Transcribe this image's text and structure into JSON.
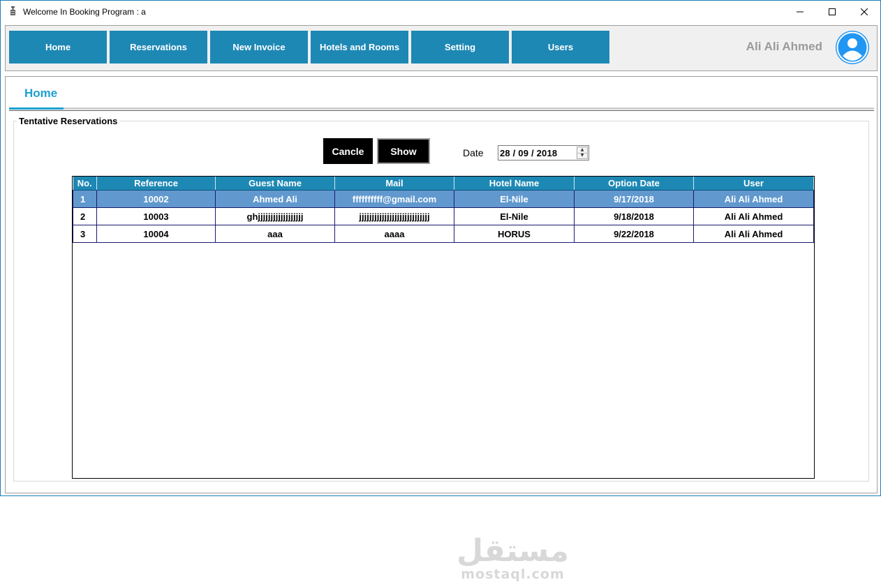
{
  "window": {
    "title": "Welcome In  Booking Program : a",
    "controls": [
      "minimize-icon",
      "maximize-icon",
      "close-icon"
    ]
  },
  "nav": {
    "items": [
      {
        "label": "Home"
      },
      {
        "label": "Reservations"
      },
      {
        "label": "New Invoice"
      },
      {
        "label": "Hotels and Rooms"
      },
      {
        "label": "Setting"
      },
      {
        "label": "Users"
      }
    ],
    "user_name": "Ali Ali Ahmed",
    "avatar_icon": "user-avatar-icon"
  },
  "tab": {
    "title": "Home"
  },
  "group": {
    "title": "Tentative Reservations"
  },
  "actions": {
    "cancel_label": "Cancle",
    "show_label": "Show",
    "date_label": "Date",
    "date_value": "28 / 09 / 2018"
  },
  "table": {
    "headers": [
      "No.",
      "Reference",
      "Guest Name",
      "Mail",
      "Hotel Name",
      "Option Date",
      "User"
    ],
    "rows": [
      [
        "1",
        "10002",
        "Ahmed Ali",
        "ffffffffff@gmail.com",
        "El-Nile",
        "9/17/2018",
        "Ali Ali Ahmed"
      ],
      [
        "2",
        "10003",
        "ghjjjjjjjjjjjjjjjjjj",
        "jjjjjjjjjjjjjjjjjjjjjjjjjjjj",
        "El-Nile",
        "9/18/2018",
        "Ali Ali Ahmed"
      ],
      [
        "3",
        "10004",
        "aaa",
        "aaaa",
        "HORUS",
        "9/22/2018",
        "Ali Ali Ahmed"
      ]
    ],
    "selected_row": 0
  },
  "watermark": {
    "arabic": "مستقل",
    "latin": "mostaql.com"
  },
  "colors": {
    "nav_button": "#1e88b4",
    "tab_accent": "#1ea0d0",
    "selected_row": "#6199cf",
    "avatar": "#2196f3"
  }
}
